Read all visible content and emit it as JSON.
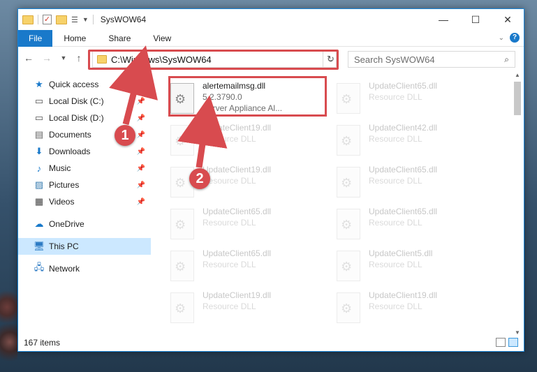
{
  "window": {
    "title": "SysWOW64",
    "caption": {
      "minimize": "—",
      "maximize": "☐",
      "close": "✕"
    }
  },
  "ribbon": {
    "tabs": [
      "File",
      "Home",
      "Share",
      "View"
    ]
  },
  "navigation": {
    "address": "C:\\Windows\\SysWOW64",
    "search_placeholder": "Search SysWOW64"
  },
  "sidebar": {
    "items": [
      {
        "label": "Quick access",
        "icon": "star-icon",
        "pinned": false
      },
      {
        "label": "Local Disk (C:)",
        "icon": "drive-icon",
        "pinned": true
      },
      {
        "label": "Local Disk (D:)",
        "icon": "drive-icon",
        "pinned": true
      },
      {
        "label": "Documents",
        "icon": "documents-icon",
        "pinned": true
      },
      {
        "label": "Downloads",
        "icon": "downloads-icon",
        "pinned": true
      },
      {
        "label": "Music",
        "icon": "music-icon",
        "pinned": true
      },
      {
        "label": "Pictures",
        "icon": "pictures-icon",
        "pinned": true
      },
      {
        "label": "Videos",
        "icon": "videos-icon",
        "pinned": true
      },
      {
        "label": "OneDrive",
        "icon": "onedrive-icon",
        "pinned": false
      },
      {
        "label": "This PC",
        "icon": "computer-icon",
        "pinned": false,
        "selected": true
      },
      {
        "label": "Network",
        "icon": "network-icon",
        "pinned": false
      }
    ]
  },
  "files": [
    {
      "name": "alertemailmsg.dll",
      "line2": "5.2.3790.0",
      "line3": "Server Appliance Al...",
      "faded": false
    },
    {
      "name": "UpdateClient65.dll",
      "line2": "Resource DLL",
      "faded": true
    },
    {
      "name": "UpdateClient19.dll",
      "line2": "Resource DLL",
      "faded": true
    },
    {
      "name": "UpdateClient42.dll",
      "line2": "Resource DLL",
      "faded": true
    },
    {
      "name": "UpdateClient19.dll",
      "line2": "Resource DLL",
      "faded": true
    },
    {
      "name": "UpdateClient65.dll",
      "line2": "Resource DLL",
      "faded": true
    },
    {
      "name": "UpdateClient65.dll",
      "line2": "Resource DLL",
      "faded": true
    },
    {
      "name": "UpdateClient65.dll",
      "line2": "Resource DLL",
      "faded": true
    },
    {
      "name": "UpdateClient65.dll",
      "line2": "Resource DLL",
      "faded": true
    },
    {
      "name": "UpdateClient5.dll",
      "line2": "Resource DLL",
      "faded": true
    },
    {
      "name": "UpdateClient19.dll",
      "line2": "Resource DLL",
      "faded": true
    },
    {
      "name": "UpdateClient19.dll",
      "line2": "Resource DLL",
      "faded": true
    }
  ],
  "status": {
    "item_count": "167 items"
  },
  "annotations": {
    "step1": "1",
    "step2": "2",
    "color": "#d84b4f"
  }
}
